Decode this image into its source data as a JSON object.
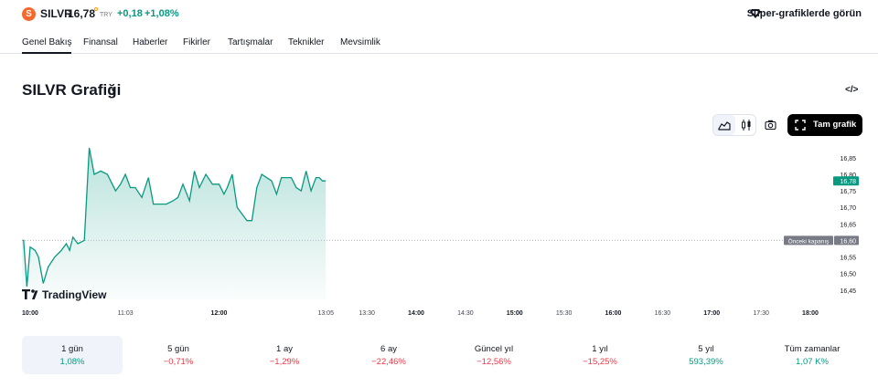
{
  "header": {
    "logo_letter": "S",
    "symbol": "SILVR",
    "price": "16,78",
    "currency": "TRY",
    "change": "+0,18",
    "change_percent": "+1,08%",
    "super_charts_label": "Süper-grafiklerde görün"
  },
  "tabs": [
    "Genel Bakış",
    "Finansal",
    "Haberler",
    "Fikirler",
    "Tartışmalar",
    "Teknikler",
    "Mevsimlik"
  ],
  "chart_title": "SILVR Grafiği",
  "embed_icon": "code-icon",
  "toolbar": {
    "full_chart_label": "Tam grafik",
    "area_icon": "area-chart-icon",
    "candle_icon": "candlestick-icon",
    "camera_icon": "camera-icon",
    "fullscreen_icon": "fullscreen-icon"
  },
  "watermark": "TradingView",
  "chart_data": {
    "type": "area",
    "series": [
      {
        "x": [
          "10:00",
          "10:01",
          "10:03",
          "10:05",
          "10:08",
          "10:10",
          "10:13",
          "10:16",
          "10:20",
          "10:24",
          "10:27",
          "10:29",
          "10:31",
          "10:34",
          "10:38",
          "10:41",
          "10:44",
          "10:48",
          "10:52",
          "10:57",
          "11:00",
          "11:03",
          "11:06",
          "11:09",
          "11:13",
          "11:17",
          "11:20",
          "11:24",
          "11:28",
          "11:32",
          "11:35",
          "11:38",
          "11:42",
          "11:45",
          "11:48",
          "11:52",
          "11:56",
          "12:00",
          "12:03",
          "12:05",
          "12:08",
          "12:11",
          "12:14",
          "12:17",
          "12:20",
          "12:23",
          "12:26",
          "12:29",
          "12:32",
          "12:35",
          "12:38",
          "12:41",
          "12:44",
          "12:47",
          "12:50",
          "12:53",
          "12:56",
          "12:59",
          "13:01",
          "13:03",
          "13:05"
        ],
        "y": [
          16.6,
          16.6,
          16.46,
          16.58,
          16.57,
          16.55,
          16.47,
          16.52,
          16.55,
          16.57,
          16.59,
          16.57,
          16.61,
          16.59,
          16.6,
          16.88,
          16.8,
          16.81,
          16.8,
          16.75,
          16.77,
          16.8,
          16.76,
          16.76,
          16.73,
          16.79,
          16.71,
          16.71,
          16.71,
          16.72,
          16.73,
          16.77,
          16.72,
          16.81,
          16.76,
          16.8,
          16.77,
          16.77,
          16.74,
          16.76,
          16.8,
          16.7,
          16.68,
          16.66,
          16.66,
          16.76,
          16.8,
          16.79,
          16.78,
          16.74,
          16.79,
          16.79,
          16.79,
          16.76,
          16.75,
          16.81,
          16.75,
          16.79,
          16.79,
          16.78,
          16.78
        ]
      }
    ],
    "x_tick_labels": [
      "10:00",
      "11:03",
      "12:00",
      "13:05",
      "13:30",
      "14:00",
      "14:30",
      "15:00",
      "15:30",
      "16:00",
      "16:30",
      "17:00",
      "17:30",
      "18:00"
    ],
    "y_tick_labels": [
      "16,85",
      "16,80",
      "16,75",
      "16,70",
      "16,65",
      "16,55",
      "16,50",
      "16,45"
    ],
    "x_range": [
      "10:00",
      "18:00"
    ],
    "y_range": [
      16.43,
      16.88
    ],
    "last_price_label": "16,78",
    "prev_close": 16.6,
    "prev_close_text": "Önceki kapanış",
    "prev_close_label": "16,60",
    "line_color": "#089981",
    "grid": false
  },
  "periods": [
    {
      "label": "1 gün",
      "value": "1,08%",
      "dir": "pos"
    },
    {
      "label": "5 gün",
      "value": "−0,71%",
      "dir": "neg"
    },
    {
      "label": "1 ay",
      "value": "−1,29%",
      "dir": "neg"
    },
    {
      "label": "6 ay",
      "value": "−22,46%",
      "dir": "neg"
    },
    {
      "label": "Güncel yıl",
      "value": "−12,56%",
      "dir": "neg"
    },
    {
      "label": "1 yıl",
      "value": "−15,25%",
      "dir": "neg"
    },
    {
      "label": "5 yıl",
      "value": "593,39%",
      "dir": "pos"
    },
    {
      "label": "Tüm zamanlar",
      "value": "1,07 K%",
      "dir": "pos"
    }
  ]
}
